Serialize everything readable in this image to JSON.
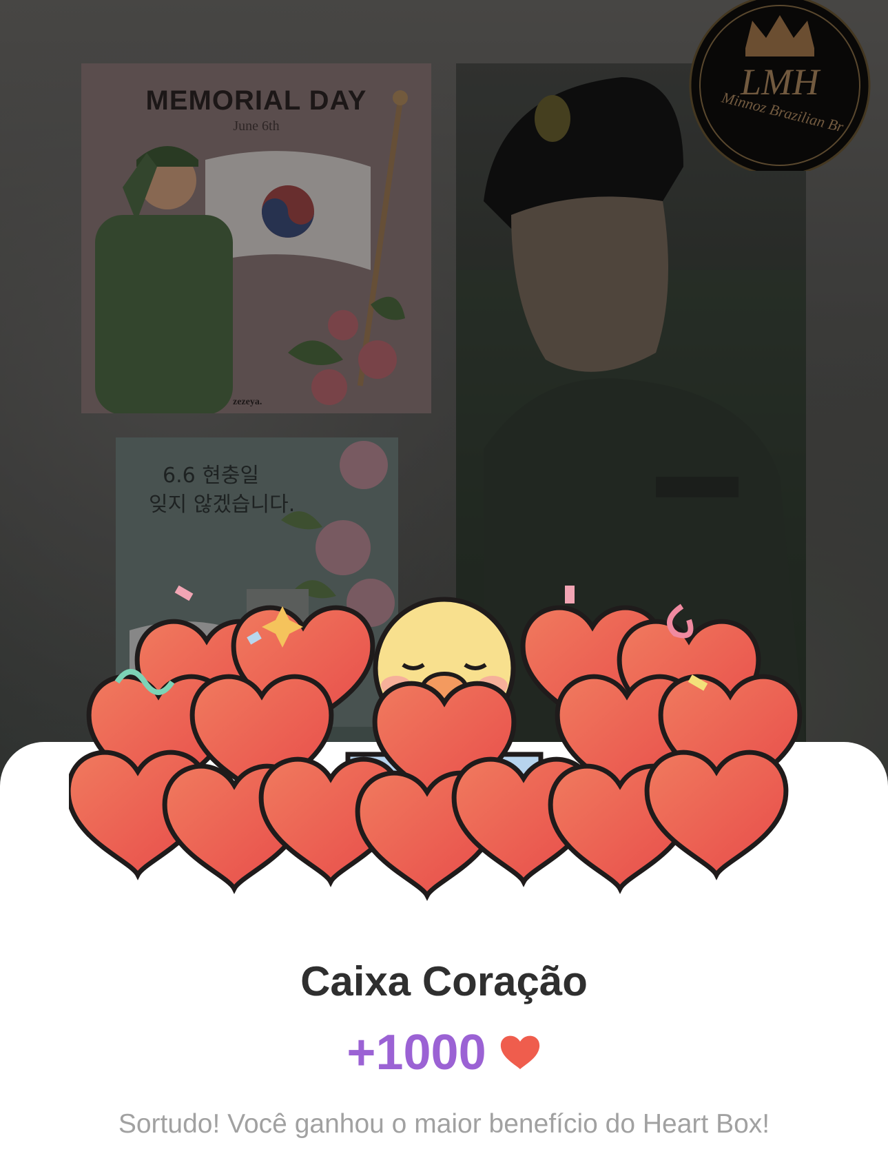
{
  "background": {
    "memorial_card": {
      "title": "MEMORIAL DAY",
      "subtitle": "June 6th",
      "brand": "zezeya."
    },
    "korean_card": {
      "line1": "6.6 현충일",
      "line2": "잊지 않겠습니다."
    },
    "logo": {
      "text": "LMH",
      "subtext": "Minnoz Brazilian Br"
    }
  },
  "sheet": {
    "title": "Caixa Coração",
    "reward_amount": "+1000",
    "reward_icon": "heart-icon",
    "message": "Sortudo! Você ganhou o maior benefício do Heart Box!"
  },
  "colors": {
    "reward": "#9b62d4",
    "heart": "#ef5d4d",
    "title": "#2f2f2f",
    "message": "#a1a1a1"
  }
}
